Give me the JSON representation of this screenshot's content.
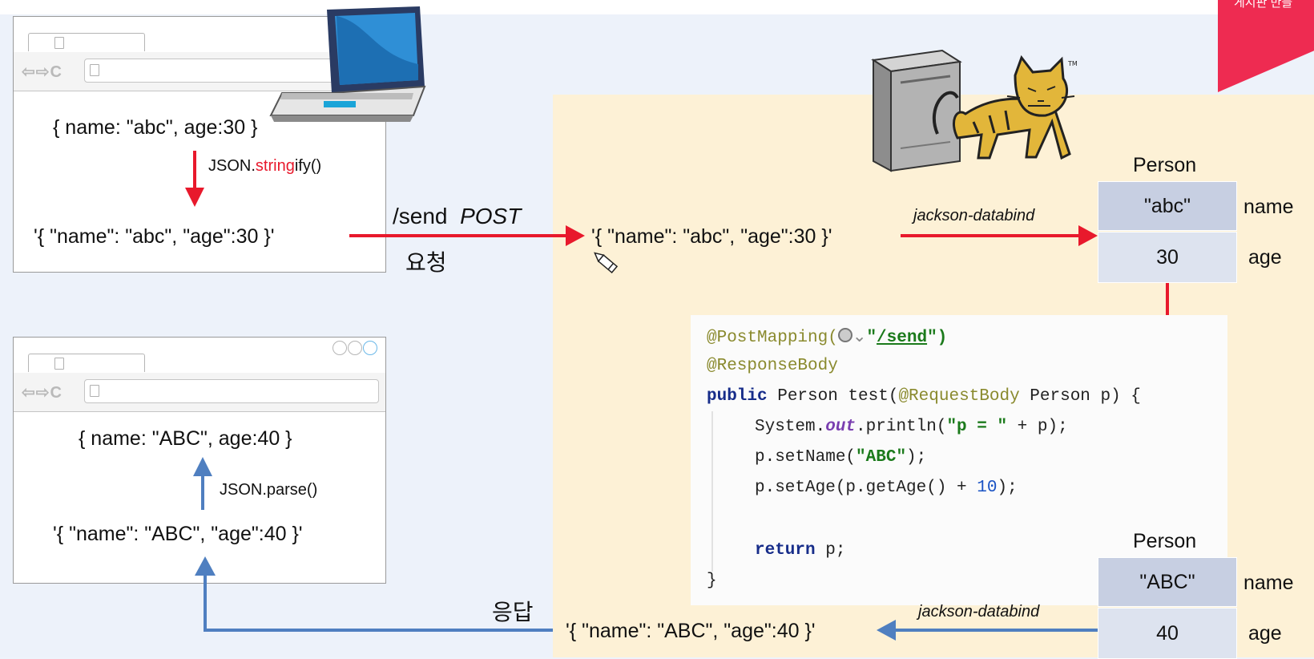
{
  "corner_label": "게시판 만들",
  "client_top": {
    "object_text": "{ name: \"abc\", age:30 }",
    "method_prefix": "JSON.",
    "method_highlight": "string",
    "method_suffix": "ify()",
    "string_text": "'{ \"name\": \"abc\", \"age\":30 }'"
  },
  "client_bottom": {
    "object_text": "{ name: \"ABC\", age:40 }",
    "method": "JSON.parse()",
    "string_text": "'{ \"name\": \"ABC\", \"age\":40 }'"
  },
  "request": {
    "path": "/send",
    "method": "POST",
    "label": "요청"
  },
  "response": {
    "label": "응답"
  },
  "server": {
    "incoming_json": "'{ \"name\": \"abc\", \"age\":30 }'",
    "outgoing_json": "'{ \"name\": \"ABC\", \"age\":40 }'",
    "mapper_label_in": "jackson-databind",
    "mapper_label_out": "jackson-databind"
  },
  "person_in": {
    "title": "Person",
    "name_value": "\"abc\"",
    "age_value": "30",
    "name_label": "name",
    "age_label": "age"
  },
  "person_out": {
    "title": "Person",
    "name_value": "\"ABC\"",
    "age_value": "40",
    "name_label": "name",
    "age_label": "age"
  },
  "code": {
    "anno1": "@PostMapping(",
    "path_open": "\"",
    "path": "/send",
    "path_close": "\")",
    "anno2": "@ResponseBody",
    "l3_kw": "public",
    "l3_mid": " Person test(",
    "l3_anno": "@RequestBody",
    "l3_end": " Person p) {",
    "l4_a": "System.",
    "l4_fld": "out",
    "l4_b": ".println(",
    "l4_str": "\"p = \"",
    "l4_c": " + p);",
    "l5_a": "p.setName(",
    "l5_str": "\"ABC\"",
    "l5_b": ");",
    "l6_a": "p.setAge(p.getAge() + ",
    "l6_num": "10",
    "l6_b": ");",
    "l8_kw": "return",
    "l8_b": " p;",
    "l9": "}"
  },
  "colors": {
    "red_arrow": "#e8192c",
    "blue_arrow": "#4f7fc0",
    "server_bg": "#fdf1d6",
    "cell_top": "#c7cfe2",
    "cell": "#dde3ef"
  },
  "icons": [
    "laptop-icon",
    "server-icon",
    "tomcat-icon",
    "pencil-cursor-icon"
  ]
}
